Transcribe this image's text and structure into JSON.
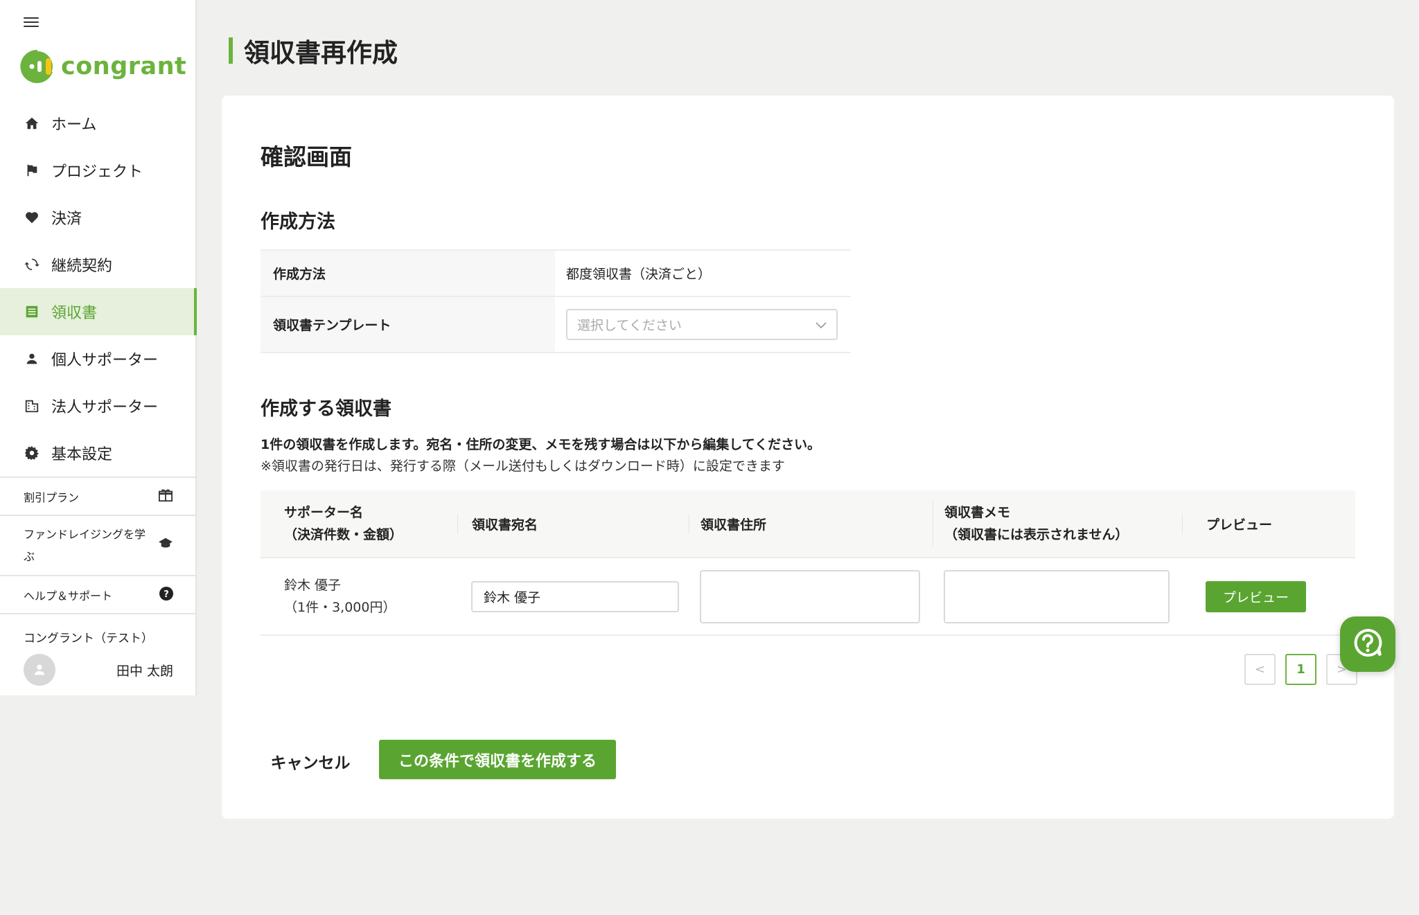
{
  "app": {
    "logo_text": "congrant",
    "brand_color": "#6cb33e"
  },
  "sidebar": {
    "items": [
      {
        "label": "ホーム",
        "icon": "home-icon"
      },
      {
        "label": "プロジェクト",
        "icon": "flag-icon"
      },
      {
        "label": "決済",
        "icon": "heart-icon"
      },
      {
        "label": "継続契約",
        "icon": "refresh-icon"
      },
      {
        "label": "領収書",
        "icon": "receipt-icon",
        "active": true
      },
      {
        "label": "個人サポーター",
        "icon": "person-icon"
      },
      {
        "label": "法人サポーター",
        "icon": "building-icon"
      },
      {
        "label": "基本設定",
        "icon": "gear-icon"
      }
    ],
    "links": [
      {
        "label": "割引プラン",
        "icon": "gift-icon"
      },
      {
        "label": "ファンドレイジングを学ぶ",
        "icon": "graduation-cap-icon"
      },
      {
        "label": "ヘルプ＆サポート",
        "icon": "question-icon"
      }
    ],
    "org_name": "コングラント（テスト）",
    "user_name": "田中 太朗"
  },
  "page": {
    "title": "領収書再作成"
  },
  "confirm": {
    "heading": "確認画面",
    "method_heading": "作成方法",
    "method_label": "作成方法",
    "method_value": "都度領収書（決済ごと）",
    "template_label": "領収書テンプレート",
    "template_placeholder": "選択してください"
  },
  "receipts": {
    "heading": "作成する領収書",
    "desc1": "1件の領収書を作成します。宛名・住所の変更、メモを残す場合は以下から編集してください。",
    "desc2": "※領収書の発行日は、発行する際（メール送付もしくはダウンロード時）に設定できます",
    "columns": {
      "supporter_line1": "サポーター名",
      "supporter_line2": "（決済件数・金額）",
      "addressee": "領収書宛名",
      "address": "領収書住所",
      "memo_line1": "領収書メモ",
      "memo_line2": "（領収書には表示されません）",
      "preview": "プレビュー"
    },
    "rows": [
      {
        "name": "鈴木 優子",
        "summary": "（1件・3,000円）",
        "addressee_value": "鈴木 優子",
        "address_value": "",
        "memo_value": "",
        "preview_label": "プレビュー"
      }
    ],
    "pagination": {
      "current": "1",
      "prev": "<",
      "next": ">"
    }
  },
  "actions": {
    "cancel_label": "キャンセル",
    "submit_label": "この条件で領収書を作成する"
  }
}
